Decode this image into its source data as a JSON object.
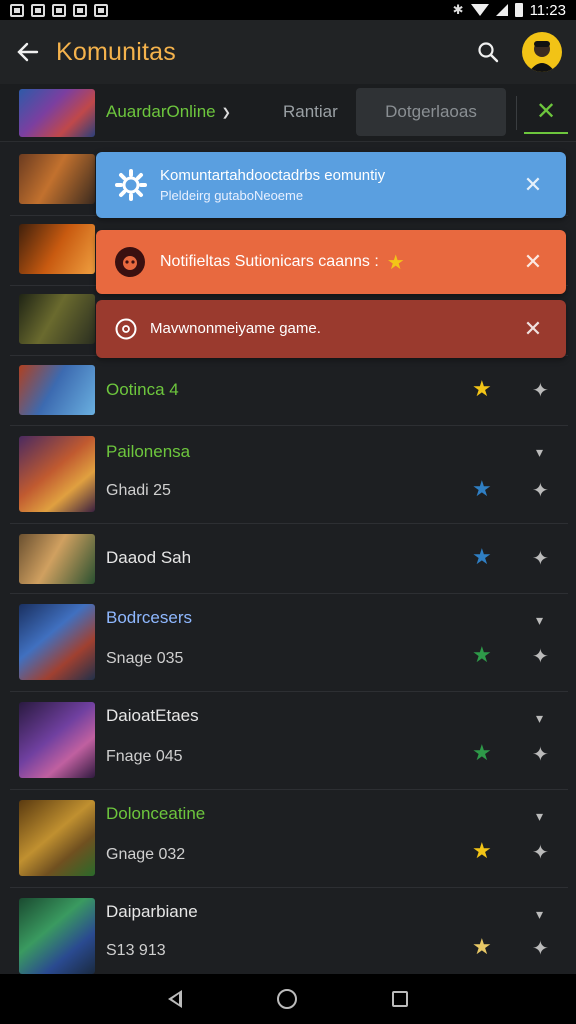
{
  "status_bar": {
    "time": "11:23"
  },
  "app_bar": {
    "title": "Komunitas"
  },
  "tabs": {
    "game_label": "Auardar​Online",
    "rating_label": "Rantiar",
    "categories_label": "Dotgerlaoas"
  },
  "banners": {
    "info": {
      "line1": "Komuntartahdooctadrbs eomuntiy",
      "line2": "Pleldeirg gutaboNeoeme"
    },
    "warn": {
      "text": "Notifieltas Sutionicars caanns :"
    },
    "error": {
      "text": "Mavwnonmeiyame game."
    }
  },
  "rows": [
    {
      "title": "Ootinca 4",
      "subtitle": ""
    },
    {
      "title": "Pailonensa",
      "subtitle": "Ghadi 25"
    },
    {
      "title": "Daaod Sah",
      "subtitle": ""
    },
    {
      "title": "Bodrcesers",
      "subtitle": "Snage 035"
    },
    {
      "title": "DaioatEtaes",
      "subtitle": "Fnage 045"
    },
    {
      "title": "Dolonceatine",
      "subtitle": "Gnage 032"
    },
    {
      "title": "Daiparbiane",
      "subtitle": "S13 913"
    }
  ],
  "colors": {
    "accent_green": "#6dc63d",
    "title_orange": "#f4b24c",
    "star_yellow": "#f3c517",
    "star_blue": "#2f7fc4",
    "star_green": "#2e9a49",
    "info_banner": "#5a9fe0",
    "warn_banner": "#e8693f",
    "error_banner": "#9a3a2e"
  },
  "icons": [
    "back-arrow-icon",
    "search-icon",
    "gear-icon",
    "close-icon",
    "star-icon",
    "pin-icon",
    "chevron-down-icon"
  ]
}
